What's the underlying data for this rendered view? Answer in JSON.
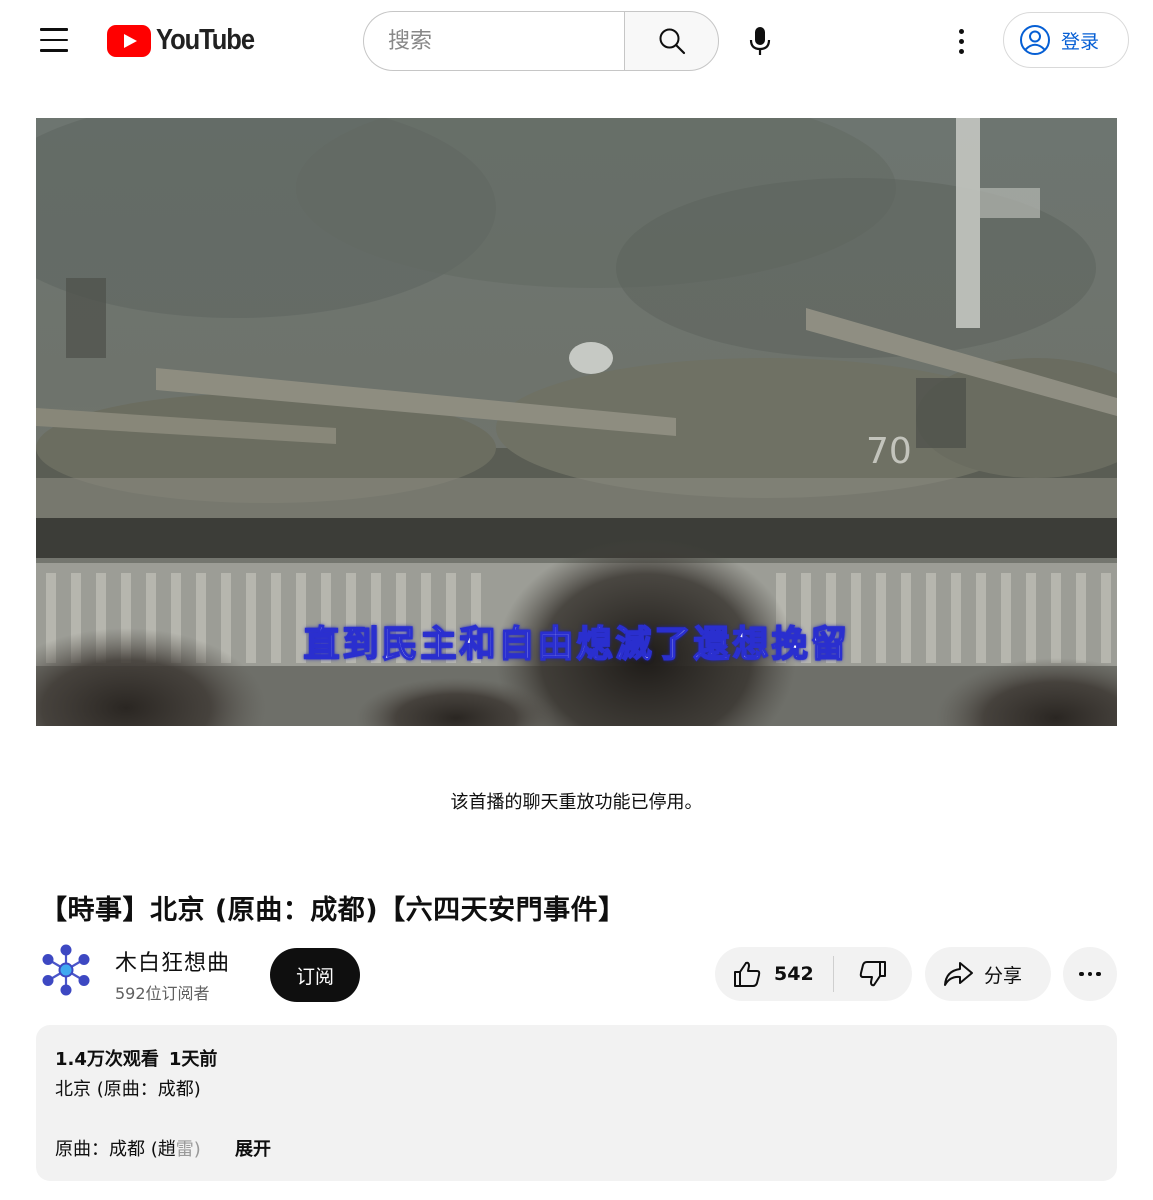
{
  "header": {
    "logo_text": "YouTube",
    "search_placeholder": "搜索",
    "signin_label": "登录"
  },
  "video": {
    "subtitle": "直到民主和自由熄滅了還想挽留",
    "chat_replay_note": "该首播的聊天重放功能已停用。"
  },
  "title": "【時事】北京 (原曲：成都)【六四天安門事件】",
  "channel": {
    "name": "木白狂想曲",
    "subscribers": "592位订阅者",
    "subscribe_label": "订阅"
  },
  "actions": {
    "like_count": "542",
    "share_label": "分享"
  },
  "description": {
    "views": "1.4万次观看",
    "age": "1天前",
    "line1": "北京 (原曲：成都)",
    "line2_main": "原曲：成都 (趙",
    "line2_faded": "雷)",
    "expand_label": "展开"
  },
  "colors": {
    "brand_red": "#ff0000",
    "link_blue": "#065fd4",
    "subtitle_outline": "#2a2fcf"
  },
  "icons": [
    "menu-icon",
    "youtube-logo-icon",
    "search-icon",
    "microphone-icon",
    "more-vert-icon",
    "account-circle-icon",
    "thumb-up-icon",
    "thumb-down-icon",
    "share-icon",
    "more-horiz-icon"
  ]
}
